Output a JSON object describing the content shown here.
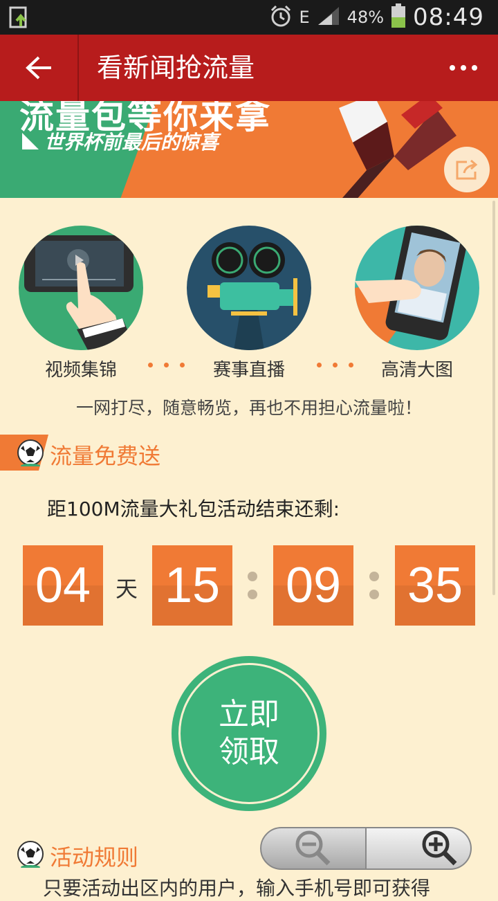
{
  "status_bar": {
    "network_type": "E",
    "battery_percent": "48%",
    "time": "08:49"
  },
  "top_bar": {
    "title": "看新闻抢流量"
  },
  "banner": {
    "headline": "流量包等你来拿",
    "subtitle": "世界杯前最后的惊喜"
  },
  "features": [
    {
      "label": "视频集锦",
      "icon": "video-icon"
    },
    {
      "label": "赛事直播",
      "icon": "movie-camera-icon"
    },
    {
      "label": "高清大图",
      "icon": "phone-photo-icon"
    }
  ],
  "tagline": "一网打尽，随意畅览，再也不用担心流量啦！",
  "free_section": {
    "title": "流量免费送"
  },
  "countdown": {
    "text": "距100M流量大礼包活动结束还剩:",
    "days": "04",
    "day_unit": "天",
    "hours": "15",
    "minutes": "09",
    "seconds": "35"
  },
  "claim_button": {
    "label": "立即领取"
  },
  "rules_section": {
    "title": "活动规则",
    "text_partial": "只要活动出区内的用户，输入手机号即可获得"
  },
  "colors": {
    "brand_red": "#b71c1c",
    "accent_orange": "#f07a35",
    "accent_green": "#3db37a",
    "background": "#fdf0d0"
  }
}
